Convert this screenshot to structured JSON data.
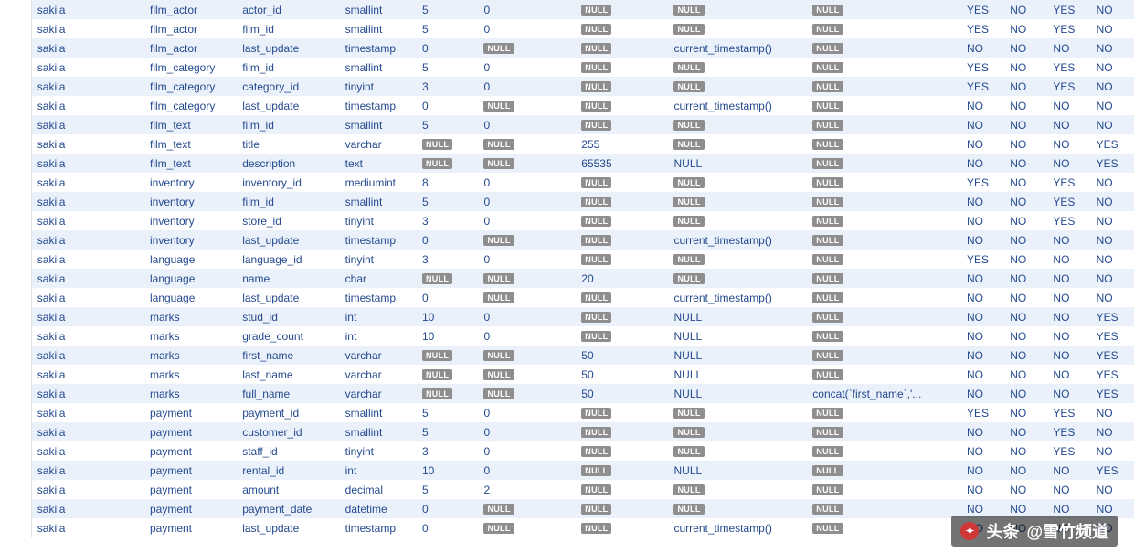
{
  "null_label": "NULL",
  "watermark": {
    "brand": "头条",
    "handle": "@雪竹频道"
  },
  "rows": [
    {
      "schema": "sakila",
      "table": "film_actor",
      "column": "actor_id",
      "type": "smallint",
      "precision": "5",
      "scale": "0",
      "charlen": null,
      "default": null,
      "genexpr": null,
      "f1": "YES",
      "f2": "NO",
      "f3": "YES",
      "f4": "NO"
    },
    {
      "schema": "sakila",
      "table": "film_actor",
      "column": "film_id",
      "type": "smallint",
      "precision": "5",
      "scale": "0",
      "charlen": null,
      "default": null,
      "genexpr": null,
      "f1": "YES",
      "f2": "NO",
      "f3": "YES",
      "f4": "NO"
    },
    {
      "schema": "sakila",
      "table": "film_actor",
      "column": "last_update",
      "type": "timestamp",
      "precision": "0",
      "scale": null,
      "charlen": null,
      "default": "current_timestamp()",
      "genexpr": null,
      "f1": "NO",
      "f2": "NO",
      "f3": "NO",
      "f4": "NO"
    },
    {
      "schema": "sakila",
      "table": "film_category",
      "column": "film_id",
      "type": "smallint",
      "precision": "5",
      "scale": "0",
      "charlen": null,
      "default": null,
      "genexpr": null,
      "f1": "YES",
      "f2": "NO",
      "f3": "YES",
      "f4": "NO"
    },
    {
      "schema": "sakila",
      "table": "film_category",
      "column": "category_id",
      "type": "tinyint",
      "precision": "3",
      "scale": "0",
      "charlen": null,
      "default": null,
      "genexpr": null,
      "f1": "YES",
      "f2": "NO",
      "f3": "YES",
      "f4": "NO"
    },
    {
      "schema": "sakila",
      "table": "film_category",
      "column": "last_update",
      "type": "timestamp",
      "precision": "0",
      "scale": null,
      "charlen": null,
      "default": "current_timestamp()",
      "genexpr": null,
      "f1": "NO",
      "f2": "NO",
      "f3": "NO",
      "f4": "NO"
    },
    {
      "schema": "sakila",
      "table": "film_text",
      "column": "film_id",
      "type": "smallint",
      "precision": "5",
      "scale": "0",
      "charlen": null,
      "default": null,
      "genexpr": null,
      "f1": "NO",
      "f2": "NO",
      "f3": "NO",
      "f4": "NO"
    },
    {
      "schema": "sakila",
      "table": "film_text",
      "column": "title",
      "type": "varchar",
      "precision": null,
      "scale": null,
      "charlen": "255",
      "default": null,
      "genexpr": null,
      "f1": "NO",
      "f2": "NO",
      "f3": "NO",
      "f4": "YES"
    },
    {
      "schema": "sakila",
      "table": "film_text",
      "column": "description",
      "type": "text",
      "precision": null,
      "scale": null,
      "charlen": "65535",
      "default": "NULL",
      "genexpr": null,
      "f1": "NO",
      "f2": "NO",
      "f3": "NO",
      "f4": "YES"
    },
    {
      "schema": "sakila",
      "table": "inventory",
      "column": "inventory_id",
      "type": "mediumint",
      "precision": "8",
      "scale": "0",
      "charlen": null,
      "default": null,
      "genexpr": null,
      "f1": "YES",
      "f2": "NO",
      "f3": "YES",
      "f4": "NO"
    },
    {
      "schema": "sakila",
      "table": "inventory",
      "column": "film_id",
      "type": "smallint",
      "precision": "5",
      "scale": "0",
      "charlen": null,
      "default": null,
      "genexpr": null,
      "f1": "NO",
      "f2": "NO",
      "f3": "YES",
      "f4": "NO"
    },
    {
      "schema": "sakila",
      "table": "inventory",
      "column": "store_id",
      "type": "tinyint",
      "precision": "3",
      "scale": "0",
      "charlen": null,
      "default": null,
      "genexpr": null,
      "f1": "NO",
      "f2": "NO",
      "f3": "YES",
      "f4": "NO"
    },
    {
      "schema": "sakila",
      "table": "inventory",
      "column": "last_update",
      "type": "timestamp",
      "precision": "0",
      "scale": null,
      "charlen": null,
      "default": "current_timestamp()",
      "genexpr": null,
      "f1": "NO",
      "f2": "NO",
      "f3": "NO",
      "f4": "NO"
    },
    {
      "schema": "sakila",
      "table": "language",
      "column": "language_id",
      "type": "tinyint",
      "precision": "3",
      "scale": "0",
      "charlen": null,
      "default": null,
      "genexpr": null,
      "f1": "YES",
      "f2": "NO",
      "f3": "NO",
      "f4": "NO"
    },
    {
      "schema": "sakila",
      "table": "language",
      "column": "name",
      "type": "char",
      "precision": null,
      "scale": null,
      "charlen": "20",
      "default": null,
      "genexpr": null,
      "f1": "NO",
      "f2": "NO",
      "f3": "NO",
      "f4": "NO"
    },
    {
      "schema": "sakila",
      "table": "language",
      "column": "last_update",
      "type": "timestamp",
      "precision": "0",
      "scale": null,
      "charlen": null,
      "default": "current_timestamp()",
      "genexpr": null,
      "f1": "NO",
      "f2": "NO",
      "f3": "NO",
      "f4": "NO"
    },
    {
      "schema": "sakila",
      "table": "marks",
      "column": "stud_id",
      "type": "int",
      "precision": "10",
      "scale": "0",
      "charlen": null,
      "default": "NULL",
      "genexpr": null,
      "f1": "NO",
      "f2": "NO",
      "f3": "NO",
      "f4": "YES"
    },
    {
      "schema": "sakila",
      "table": "marks",
      "column": "grade_count",
      "type": "int",
      "precision": "10",
      "scale": "0",
      "charlen": null,
      "default": "NULL",
      "genexpr": null,
      "f1": "NO",
      "f2": "NO",
      "f3": "NO",
      "f4": "YES"
    },
    {
      "schema": "sakila",
      "table": "marks",
      "column": "first_name",
      "type": "varchar",
      "precision": null,
      "scale": null,
      "charlen": "50",
      "default": "NULL",
      "genexpr": null,
      "f1": "NO",
      "f2": "NO",
      "f3": "NO",
      "f4": "YES"
    },
    {
      "schema": "sakila",
      "table": "marks",
      "column": "last_name",
      "type": "varchar",
      "precision": null,
      "scale": null,
      "charlen": "50",
      "default": "NULL",
      "genexpr": null,
      "f1": "NO",
      "f2": "NO",
      "f3": "NO",
      "f4": "YES"
    },
    {
      "schema": "sakila",
      "table": "marks",
      "column": "full_name",
      "type": "varchar",
      "precision": null,
      "scale": null,
      "charlen": "50",
      "default": "NULL",
      "genexpr": "concat(`first_name`,'...",
      "f1": "NO",
      "f2": "NO",
      "f3": "NO",
      "f4": "YES"
    },
    {
      "schema": "sakila",
      "table": "payment",
      "column": "payment_id",
      "type": "smallint",
      "precision": "5",
      "scale": "0",
      "charlen": null,
      "default": null,
      "genexpr": null,
      "f1": "YES",
      "f2": "NO",
      "f3": "YES",
      "f4": "NO"
    },
    {
      "schema": "sakila",
      "table": "payment",
      "column": "customer_id",
      "type": "smallint",
      "precision": "5",
      "scale": "0",
      "charlen": null,
      "default": null,
      "genexpr": null,
      "f1": "NO",
      "f2": "NO",
      "f3": "YES",
      "f4": "NO"
    },
    {
      "schema": "sakila",
      "table": "payment",
      "column": "staff_id",
      "type": "tinyint",
      "precision": "3",
      "scale": "0",
      "charlen": null,
      "default": null,
      "genexpr": null,
      "f1": "NO",
      "f2": "NO",
      "f3": "YES",
      "f4": "NO"
    },
    {
      "schema": "sakila",
      "table": "payment",
      "column": "rental_id",
      "type": "int",
      "precision": "10",
      "scale": "0",
      "charlen": null,
      "default": "NULL",
      "genexpr": null,
      "f1": "NO",
      "f2": "NO",
      "f3": "NO",
      "f4": "YES"
    },
    {
      "schema": "sakila",
      "table": "payment",
      "column": "amount",
      "type": "decimal",
      "precision": "5",
      "scale": "2",
      "charlen": null,
      "default": null,
      "genexpr": null,
      "f1": "NO",
      "f2": "NO",
      "f3": "NO",
      "f4": "NO"
    },
    {
      "schema": "sakila",
      "table": "payment",
      "column": "payment_date",
      "type": "datetime",
      "precision": "0",
      "scale": null,
      "charlen": null,
      "default": null,
      "genexpr": null,
      "f1": "NO",
      "f2": "NO",
      "f3": "NO",
      "f4": "NO"
    },
    {
      "schema": "sakila",
      "table": "payment",
      "column": "last_update",
      "type": "timestamp",
      "precision": "0",
      "scale": null,
      "charlen": null,
      "default": "current_timestamp()",
      "genexpr": null,
      "f1": "NO",
      "f2": "NO",
      "f3": "NO",
      "f4": "NO"
    }
  ]
}
